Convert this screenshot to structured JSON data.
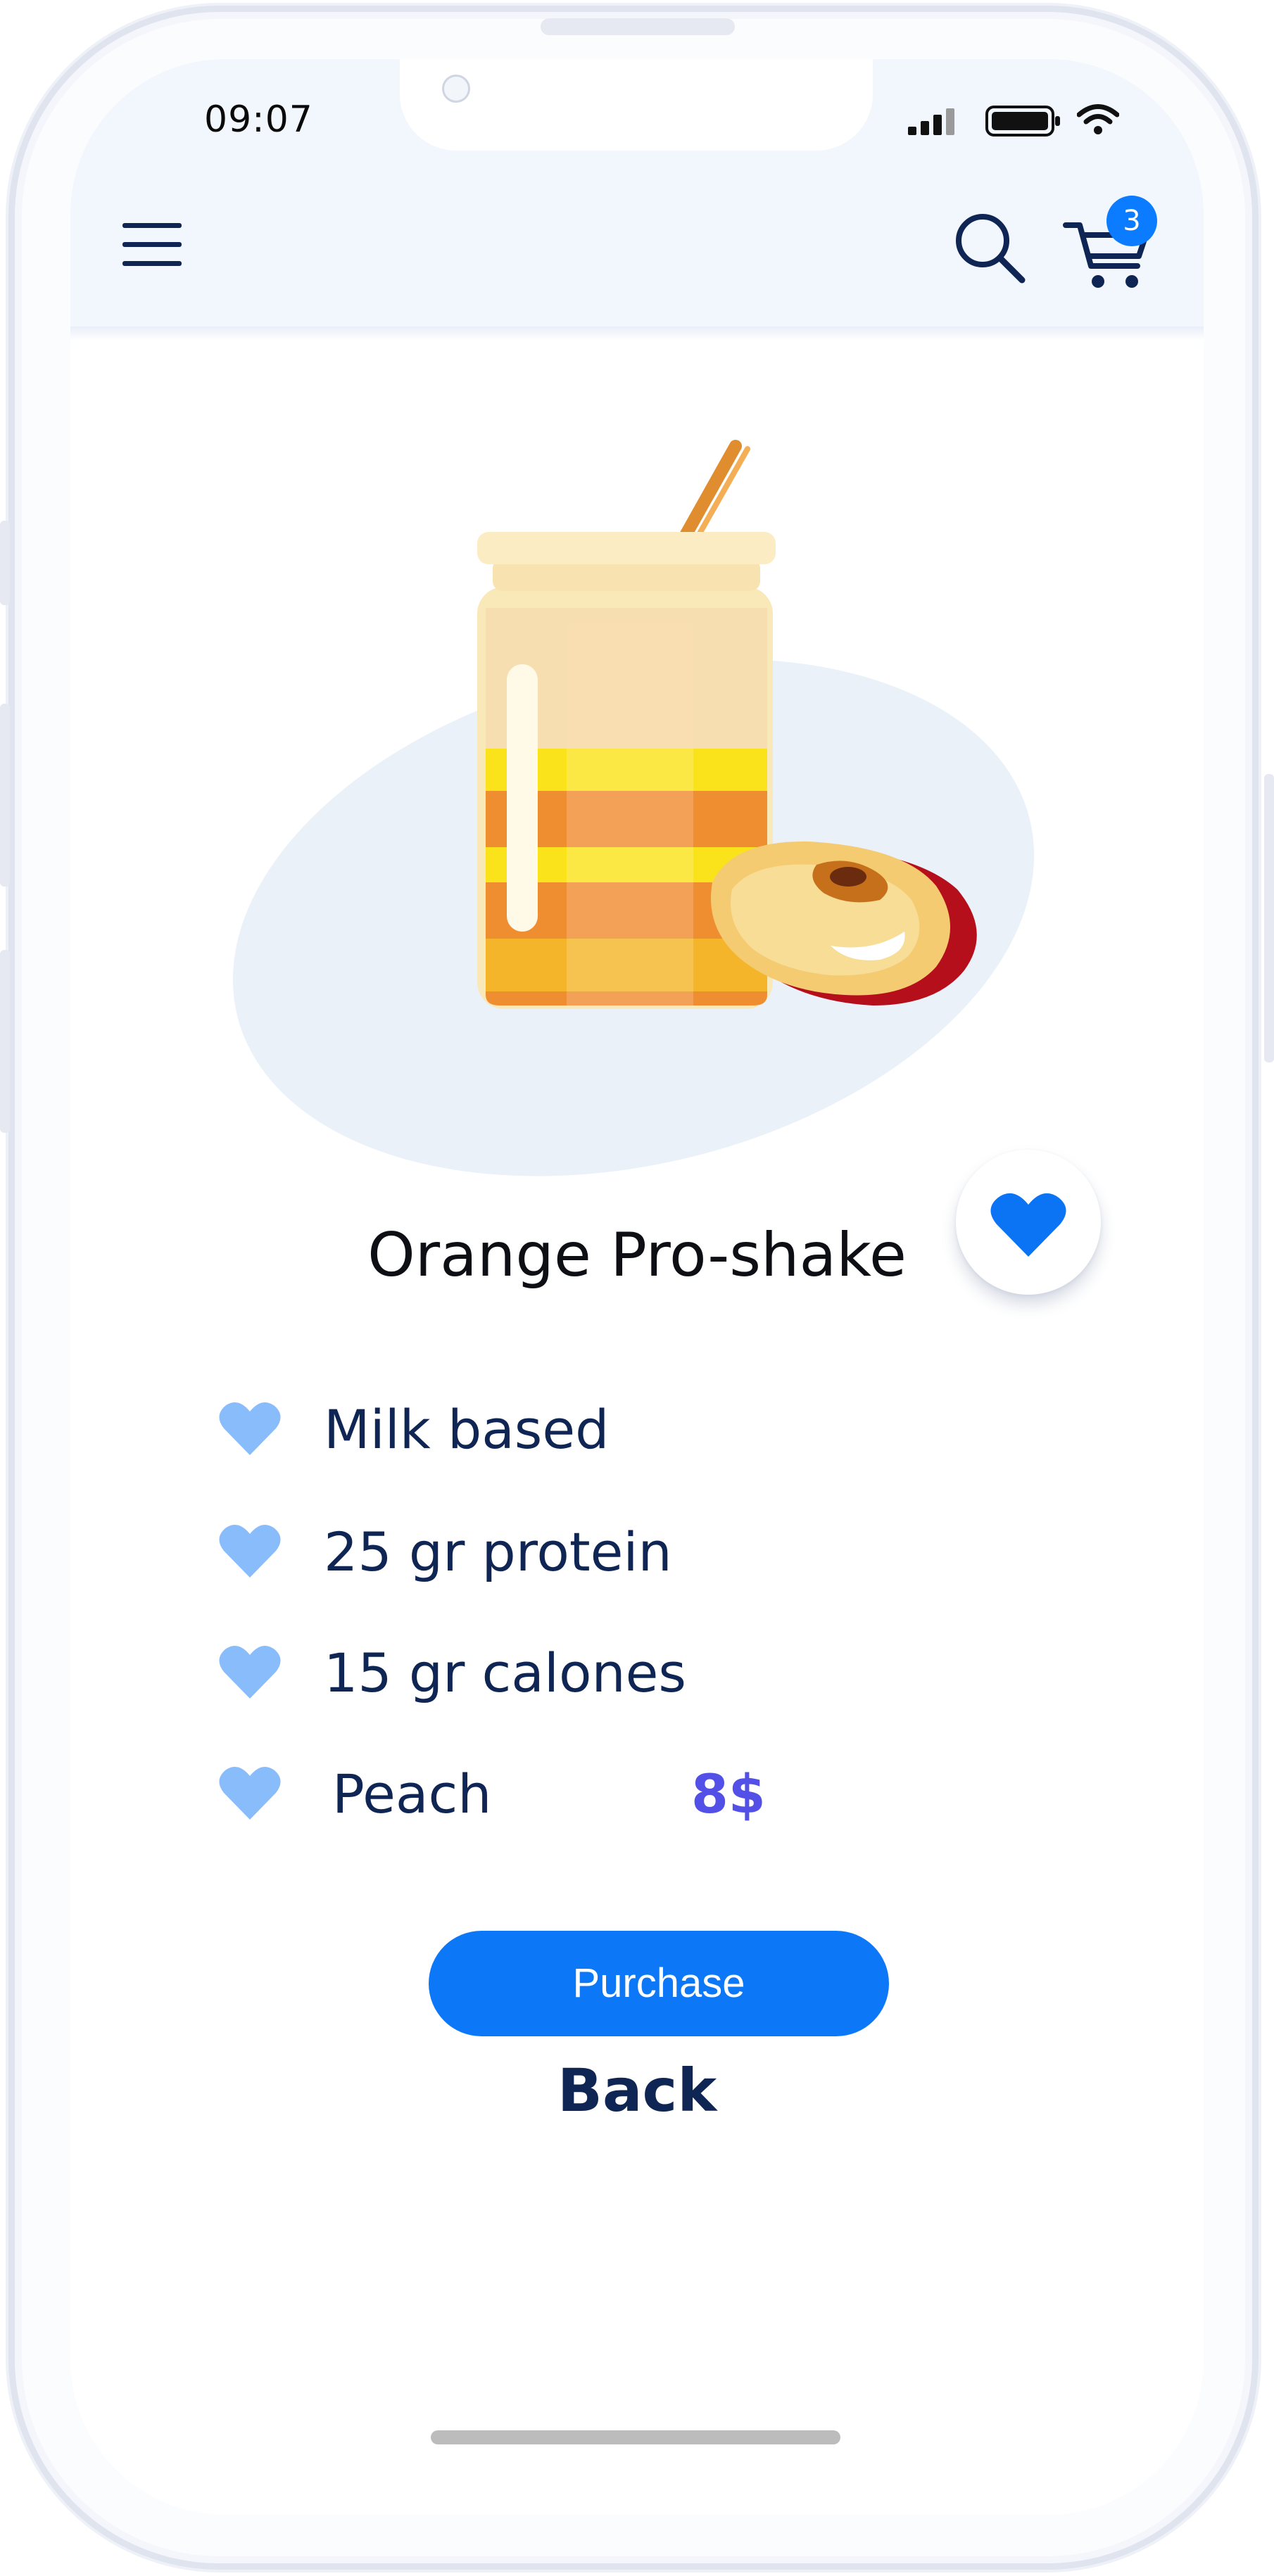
{
  "status_bar": {
    "time": "09:07"
  },
  "header": {
    "menu_icon": "hamburger-menu-icon",
    "search_icon": "search-icon",
    "cart_icon": "shopping-cart-icon",
    "cart_count": "3"
  },
  "product": {
    "name": "Orange Pro-shake",
    "image": "shake-jar-with-peach-slice",
    "favorite_icon": "heart-icon",
    "features": [
      {
        "label": "Milk based"
      },
      {
        "label": "25 gr protein"
      },
      {
        "label": "15 gr calones"
      },
      {
        "label": "Peach"
      }
    ],
    "price": "8$"
  },
  "actions": {
    "purchase_label": "Purchase",
    "back_label": "Back"
  },
  "colors": {
    "accent": "#0d78f7",
    "text_dark": "#0f2553",
    "price": "#5250e6",
    "feature_heart": "#89bcfb",
    "header_bg": "#f2f6fd"
  }
}
